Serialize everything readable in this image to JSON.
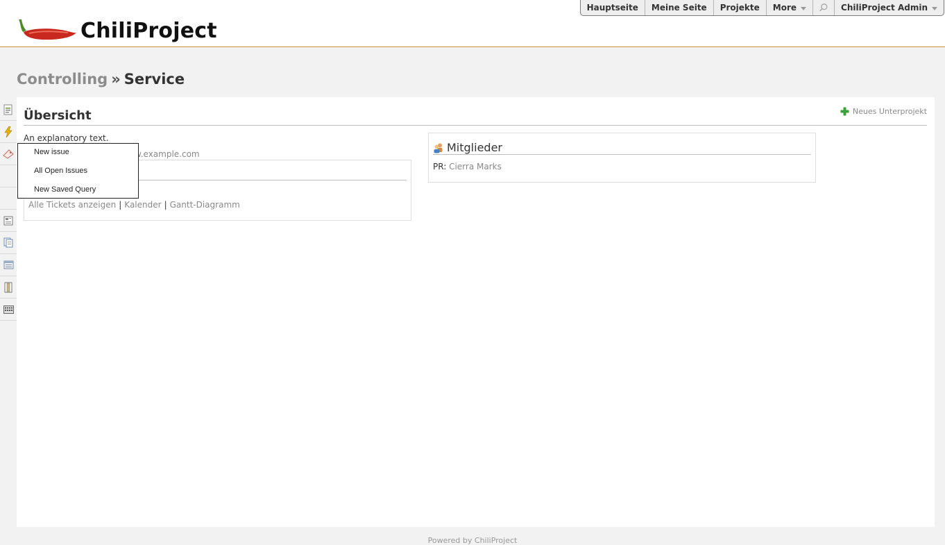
{
  "app": {
    "logo_text": "ChiliProject"
  },
  "top_menu": {
    "items": [
      "Hauptseite",
      "Meine Seite",
      "Projekte",
      "More"
    ],
    "user": "ChiliProject Admin"
  },
  "breadcrumb": {
    "parent": "Controlling",
    "separator": "»",
    "current": "Service"
  },
  "main": {
    "title": "Übersicht",
    "new_subproject": "Neues Unterprojekt",
    "description": "An explanatory text.",
    "homepage_url": "w.example.com",
    "issues_links": [
      "Alle Tickets anzeigen",
      "Kalender",
      "Gantt-Diagramm"
    ],
    "members": {
      "title": "Mitglieder",
      "role": "PR",
      "name": "Cierra Marks"
    }
  },
  "popup_menu": {
    "items": [
      "New issue",
      "All Open Issues",
      "New Saved Query"
    ]
  },
  "sidebar_icons": [
    "overview-icon",
    "activity-icon",
    "issues-icon",
    "blank",
    "blank",
    "news-icon",
    "documents-icon",
    "wiki-icon",
    "files-icon",
    "settings-icon"
  ],
  "footer": {
    "text": "Powered by ChiliProject"
  },
  "colors": {
    "header_border": "#d28d3d",
    "accent_green": "#3ca13c",
    "chili_red": "#c8281e"
  }
}
